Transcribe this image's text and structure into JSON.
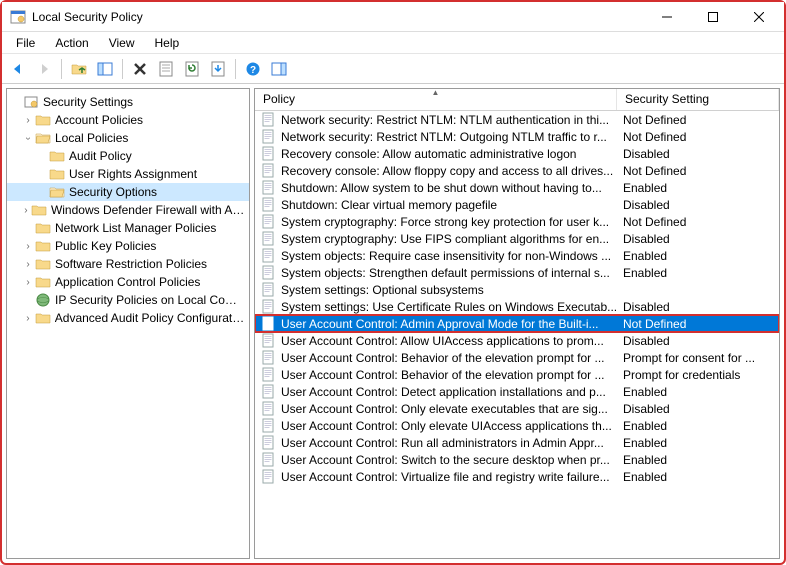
{
  "window": {
    "title": "Local Security Policy"
  },
  "menu": {
    "file": "File",
    "action": "Action",
    "view": "View",
    "help": "Help"
  },
  "tree": {
    "root": "Security Settings",
    "account_policies": "Account Policies",
    "local_policies": "Local Policies",
    "audit_policy": "Audit Policy",
    "user_rights": "User Rights Assignment",
    "security_options": "Security Options",
    "wdf": "Windows Defender Firewall with Advanced Security",
    "nlmp": "Network List Manager Policies",
    "pkp": "Public Key Policies",
    "srp": "Software Restriction Policies",
    "acp": "Application Control Policies",
    "ipsec": "IP Security Policies on Local Computer",
    "aapc": "Advanced Audit Policy Configuration"
  },
  "columns": {
    "policy": "Policy",
    "setting": "Security Setting"
  },
  "policies": [
    {
      "name": "Network security: Restrict NTLM: NTLM authentication in thi...",
      "setting": "Not Defined"
    },
    {
      "name": "Network security: Restrict NTLM: Outgoing NTLM traffic to r...",
      "setting": "Not Defined"
    },
    {
      "name": "Recovery console: Allow automatic administrative logon",
      "setting": "Disabled"
    },
    {
      "name": "Recovery console: Allow floppy copy and access to all drives...",
      "setting": "Not Defined"
    },
    {
      "name": "Shutdown: Allow system to be shut down without having to...",
      "setting": "Enabled"
    },
    {
      "name": "Shutdown: Clear virtual memory pagefile",
      "setting": "Disabled"
    },
    {
      "name": "System cryptography: Force strong key protection for user k...",
      "setting": "Not Defined"
    },
    {
      "name": "System cryptography: Use FIPS compliant algorithms for en...",
      "setting": "Disabled"
    },
    {
      "name": "System objects: Require case insensitivity for non-Windows ...",
      "setting": "Enabled"
    },
    {
      "name": "System objects: Strengthen default permissions of internal s...",
      "setting": "Enabled"
    },
    {
      "name": "System settings: Optional subsystems",
      "setting": ""
    },
    {
      "name": "System settings: Use Certificate Rules on Windows Executab...",
      "setting": "Disabled"
    },
    {
      "name": "User Account Control: Admin Approval Mode for the Built-i...",
      "setting": "Not Defined",
      "selected": true,
      "highlighted": true
    },
    {
      "name": "User Account Control: Allow UIAccess applications to prom...",
      "setting": "Disabled"
    },
    {
      "name": "User Account Control: Behavior of the elevation prompt for ...",
      "setting": "Prompt for consent for ..."
    },
    {
      "name": "User Account Control: Behavior of the elevation prompt for ...",
      "setting": "Prompt for credentials"
    },
    {
      "name": "User Account Control: Detect application installations and p...",
      "setting": "Enabled"
    },
    {
      "name": "User Account Control: Only elevate executables that are sig...",
      "setting": "Disabled"
    },
    {
      "name": "User Account Control: Only elevate UIAccess applications th...",
      "setting": "Enabled"
    },
    {
      "name": "User Account Control: Run all administrators in Admin Appr...",
      "setting": "Enabled"
    },
    {
      "name": "User Account Control: Switch to the secure desktop when pr...",
      "setting": "Enabled"
    },
    {
      "name": "User Account Control: Virtualize file and registry write failure...",
      "setting": "Enabled"
    }
  ]
}
